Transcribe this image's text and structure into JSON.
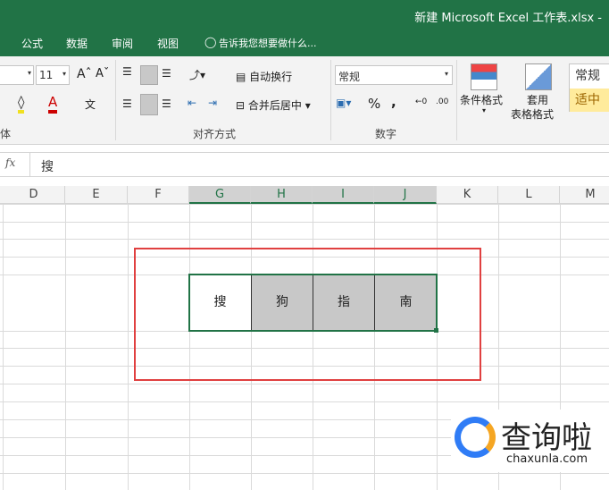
{
  "window": {
    "title": "新建 Microsoft Excel 工作表.xlsx -"
  },
  "tabs": [
    "公式",
    "数据",
    "审阅",
    "视图"
  ],
  "tell_me": "告诉我您想要做什么...",
  "ribbon": {
    "font_size": "11",
    "font_group": "体",
    "wrap_text": "自动换行",
    "merge_center": "合并后居中",
    "align_group": "对齐方式",
    "number_format": "常规",
    "number_group": "数字",
    "percent": "%",
    "comma": ",",
    "cond_format": "条件格式",
    "table_format_1": "套用",
    "table_format_2": "表格格式",
    "style_normal": "常规",
    "style_neutral": "适中"
  },
  "formula_bar": {
    "fx": "fx",
    "value": "搜"
  },
  "columns": [
    "D",
    "E",
    "F",
    "G",
    "H",
    "I",
    "J",
    "K",
    "L",
    "M"
  ],
  "cells": {
    "G": "搜",
    "H": "狗",
    "I": "指",
    "J": "南"
  },
  "watermark": {
    "text": "查询啦",
    "url": "chaxunla.com"
  },
  "colors": {
    "excel_green": "#217346",
    "highlight": "#e04040",
    "cell_gray": "#c8c8c8"
  }
}
